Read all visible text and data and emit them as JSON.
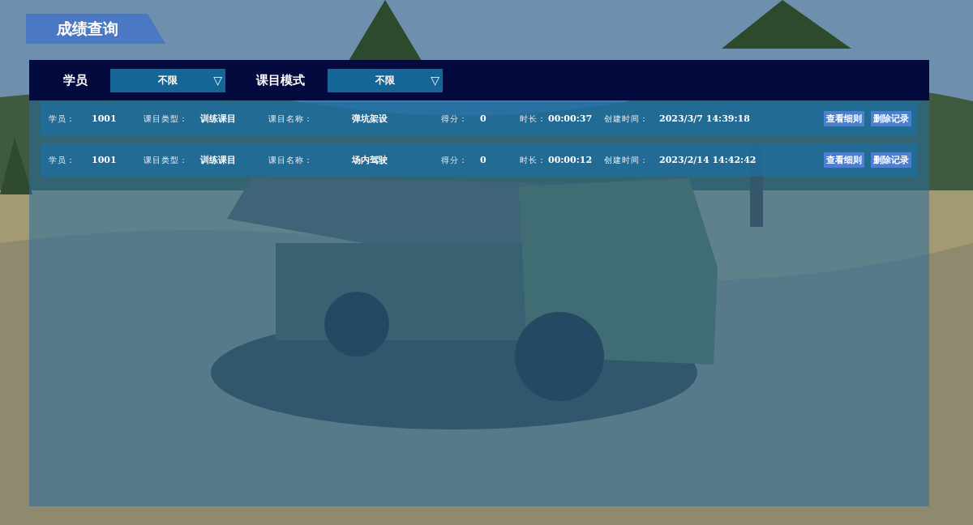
{
  "title": "成绩查询",
  "filters": [
    {
      "label": "学员",
      "value": "不限",
      "arrow": "▽"
    },
    {
      "label": "课目模式",
      "value": "不限",
      "arrow": "▽"
    }
  ],
  "records": [
    {
      "fields": [
        {
          "label": "学员：",
          "value": "1001"
        },
        {
          "label": "课目类型：",
          "value": "训练课目"
        },
        {
          "label": "课目名称：",
          "value": "弹坑架设"
        },
        {
          "label": "得分：",
          "value": "0"
        },
        {
          "label": "时长：",
          "value": "00:00:37"
        },
        {
          "label": "创建时间：",
          "value": "2023/3/7 14:39:18"
        }
      ],
      "actions": [
        "查看细则",
        "删除记录"
      ]
    },
    {
      "fields": [
        {
          "label": "学员：",
          "value": "1001"
        },
        {
          "label": "课目类型：",
          "value": "训练课目"
        },
        {
          "label": "课目名称：",
          "value": "场内驾驶"
        },
        {
          "label": "得分：",
          "value": "0"
        },
        {
          "label": "时长：",
          "value": "00:00:12"
        },
        {
          "label": "创建时间：",
          "value": "2023/2/14 14:42:42"
        }
      ],
      "actions": [
        "查看细则",
        "删除记录"
      ]
    }
  ]
}
